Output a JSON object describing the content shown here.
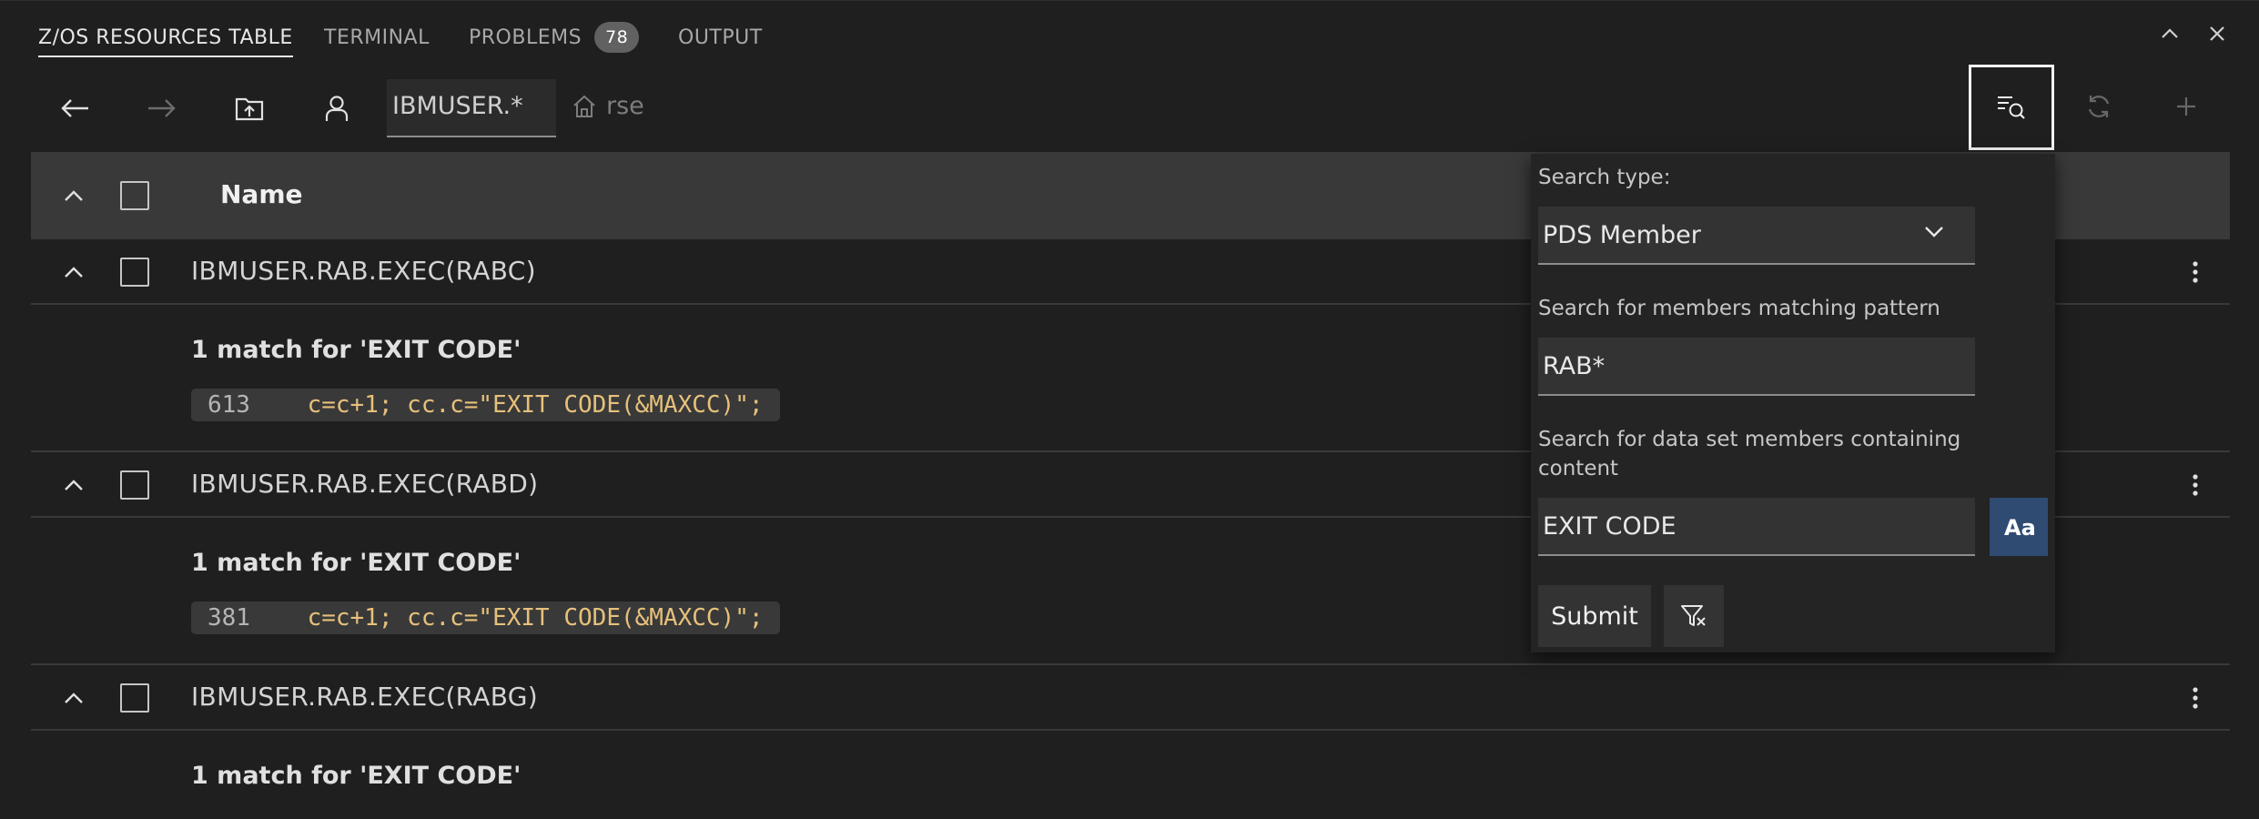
{
  "panel_tabs": [
    {
      "label": "Z/OS RESOURCES TABLE"
    },
    {
      "label": "TERMINAL"
    },
    {
      "label": "PROBLEMS",
      "badge": "78"
    },
    {
      "label": "OUTPUT"
    }
  ],
  "toolbar": {
    "path_value": "IBMUSER.*",
    "home_label": "rse"
  },
  "table": {
    "header_name": "Name",
    "rows": [
      {
        "name": "IBMUSER.RAB.EXEC(RABC)",
        "match_title": "1 match for 'EXIT CODE'",
        "line": "613",
        "code": "c=c+1; cc.c=\"EXIT CODE(&MAXCC)\";"
      },
      {
        "name": "IBMUSER.RAB.EXEC(RABD)",
        "match_title": "1 match for 'EXIT CODE'",
        "line": "381",
        "code": "c=c+1; cc.c=\"EXIT CODE(&MAXCC)\";"
      },
      {
        "name": "IBMUSER.RAB.EXEC(RABG)",
        "match_title": "1 match for 'EXIT CODE'"
      }
    ]
  },
  "search": {
    "type_label": "Search type:",
    "type_value": "PDS Member",
    "pattern_label": "Search for members matching pattern",
    "pattern_value": "RAB*",
    "content_label_line1": "Search for data set members containing",
    "content_label_line2": "content",
    "content_value": "EXIT CODE",
    "case_glyph": "Aa",
    "submit_label": "Submit"
  },
  "colors": {
    "background": "#1f1f1f",
    "header_row": "#393939",
    "accent_case_button": "#2f4b72",
    "code_text": "#e6c07b"
  }
}
